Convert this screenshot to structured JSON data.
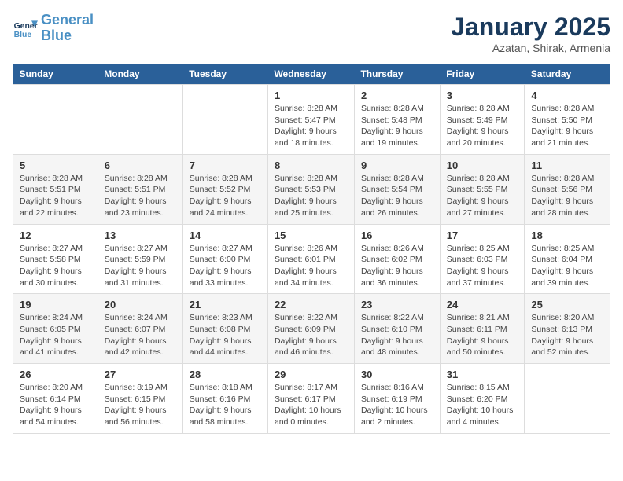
{
  "logo": {
    "line1": "General",
    "line2": "Blue"
  },
  "title": "January 2025",
  "subtitle": "Azatan, Shirak, Armenia",
  "days_of_week": [
    "Sunday",
    "Monday",
    "Tuesday",
    "Wednesday",
    "Thursday",
    "Friday",
    "Saturday"
  ],
  "weeks": [
    [
      {
        "num": "",
        "info": ""
      },
      {
        "num": "",
        "info": ""
      },
      {
        "num": "",
        "info": ""
      },
      {
        "num": "1",
        "info": "Sunrise: 8:28 AM\nSunset: 5:47 PM\nDaylight: 9 hours\nand 18 minutes."
      },
      {
        "num": "2",
        "info": "Sunrise: 8:28 AM\nSunset: 5:48 PM\nDaylight: 9 hours\nand 19 minutes."
      },
      {
        "num": "3",
        "info": "Sunrise: 8:28 AM\nSunset: 5:49 PM\nDaylight: 9 hours\nand 20 minutes."
      },
      {
        "num": "4",
        "info": "Sunrise: 8:28 AM\nSunset: 5:50 PM\nDaylight: 9 hours\nand 21 minutes."
      }
    ],
    [
      {
        "num": "5",
        "info": "Sunrise: 8:28 AM\nSunset: 5:51 PM\nDaylight: 9 hours\nand 22 minutes."
      },
      {
        "num": "6",
        "info": "Sunrise: 8:28 AM\nSunset: 5:51 PM\nDaylight: 9 hours\nand 23 minutes."
      },
      {
        "num": "7",
        "info": "Sunrise: 8:28 AM\nSunset: 5:52 PM\nDaylight: 9 hours\nand 24 minutes."
      },
      {
        "num": "8",
        "info": "Sunrise: 8:28 AM\nSunset: 5:53 PM\nDaylight: 9 hours\nand 25 minutes."
      },
      {
        "num": "9",
        "info": "Sunrise: 8:28 AM\nSunset: 5:54 PM\nDaylight: 9 hours\nand 26 minutes."
      },
      {
        "num": "10",
        "info": "Sunrise: 8:28 AM\nSunset: 5:55 PM\nDaylight: 9 hours\nand 27 minutes."
      },
      {
        "num": "11",
        "info": "Sunrise: 8:28 AM\nSunset: 5:56 PM\nDaylight: 9 hours\nand 28 minutes."
      }
    ],
    [
      {
        "num": "12",
        "info": "Sunrise: 8:27 AM\nSunset: 5:58 PM\nDaylight: 9 hours\nand 30 minutes."
      },
      {
        "num": "13",
        "info": "Sunrise: 8:27 AM\nSunset: 5:59 PM\nDaylight: 9 hours\nand 31 minutes."
      },
      {
        "num": "14",
        "info": "Sunrise: 8:27 AM\nSunset: 6:00 PM\nDaylight: 9 hours\nand 33 minutes."
      },
      {
        "num": "15",
        "info": "Sunrise: 8:26 AM\nSunset: 6:01 PM\nDaylight: 9 hours\nand 34 minutes."
      },
      {
        "num": "16",
        "info": "Sunrise: 8:26 AM\nSunset: 6:02 PM\nDaylight: 9 hours\nand 36 minutes."
      },
      {
        "num": "17",
        "info": "Sunrise: 8:25 AM\nSunset: 6:03 PM\nDaylight: 9 hours\nand 37 minutes."
      },
      {
        "num": "18",
        "info": "Sunrise: 8:25 AM\nSunset: 6:04 PM\nDaylight: 9 hours\nand 39 minutes."
      }
    ],
    [
      {
        "num": "19",
        "info": "Sunrise: 8:24 AM\nSunset: 6:05 PM\nDaylight: 9 hours\nand 41 minutes."
      },
      {
        "num": "20",
        "info": "Sunrise: 8:24 AM\nSunset: 6:07 PM\nDaylight: 9 hours\nand 42 minutes."
      },
      {
        "num": "21",
        "info": "Sunrise: 8:23 AM\nSunset: 6:08 PM\nDaylight: 9 hours\nand 44 minutes."
      },
      {
        "num": "22",
        "info": "Sunrise: 8:22 AM\nSunset: 6:09 PM\nDaylight: 9 hours\nand 46 minutes."
      },
      {
        "num": "23",
        "info": "Sunrise: 8:22 AM\nSunset: 6:10 PM\nDaylight: 9 hours\nand 48 minutes."
      },
      {
        "num": "24",
        "info": "Sunrise: 8:21 AM\nSunset: 6:11 PM\nDaylight: 9 hours\nand 50 minutes."
      },
      {
        "num": "25",
        "info": "Sunrise: 8:20 AM\nSunset: 6:13 PM\nDaylight: 9 hours\nand 52 minutes."
      }
    ],
    [
      {
        "num": "26",
        "info": "Sunrise: 8:20 AM\nSunset: 6:14 PM\nDaylight: 9 hours\nand 54 minutes."
      },
      {
        "num": "27",
        "info": "Sunrise: 8:19 AM\nSunset: 6:15 PM\nDaylight: 9 hours\nand 56 minutes."
      },
      {
        "num": "28",
        "info": "Sunrise: 8:18 AM\nSunset: 6:16 PM\nDaylight: 9 hours\nand 58 minutes."
      },
      {
        "num": "29",
        "info": "Sunrise: 8:17 AM\nSunset: 6:17 PM\nDaylight: 10 hours\nand 0 minutes."
      },
      {
        "num": "30",
        "info": "Sunrise: 8:16 AM\nSunset: 6:19 PM\nDaylight: 10 hours\nand 2 minutes."
      },
      {
        "num": "31",
        "info": "Sunrise: 8:15 AM\nSunset: 6:20 PM\nDaylight: 10 hours\nand 4 minutes."
      },
      {
        "num": "",
        "info": ""
      }
    ]
  ]
}
